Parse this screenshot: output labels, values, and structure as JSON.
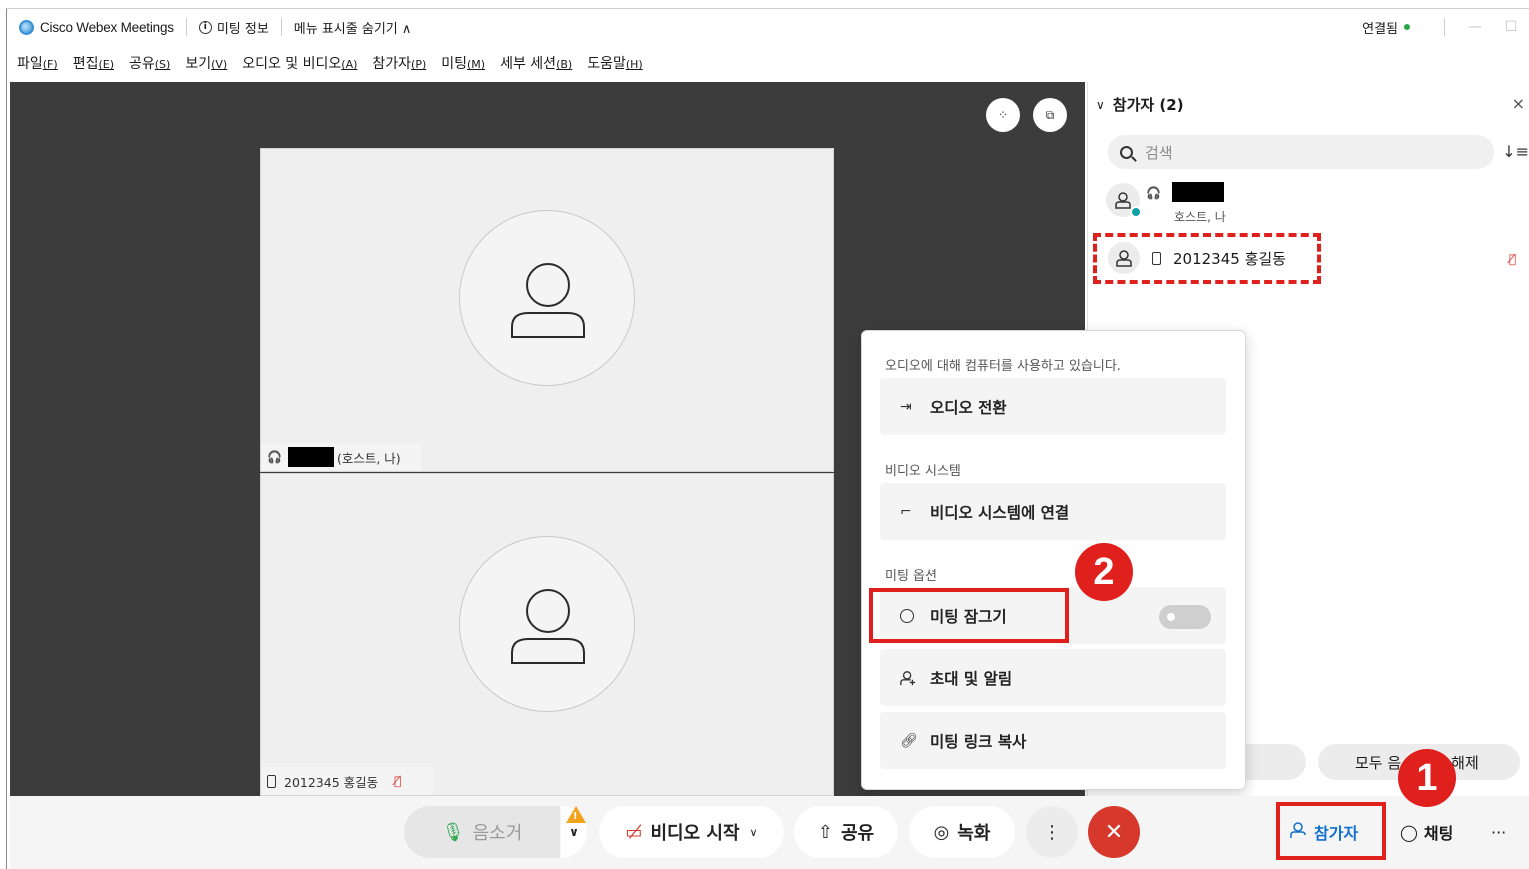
{
  "titlebar": {
    "app_name": "Cisco Webex Meetings",
    "meeting_info": "미팅 정보",
    "hide_menu": "메뉴 표시줄 숨기기 ∧",
    "connection": "연결됨",
    "minimize": "—",
    "maximize": "☐"
  },
  "menu": [
    {
      "label": "파일",
      "key": "(F)"
    },
    {
      "label": "편집",
      "key": "(E)"
    },
    {
      "label": "공유",
      "key": "(S)"
    },
    {
      "label": "보기",
      "key": "(V)"
    },
    {
      "label": "오디오 및 비디오",
      "key": "(A)"
    },
    {
      "label": "참가자",
      "key": "(P)"
    },
    {
      "label": "미팅",
      "key": "(M)"
    },
    {
      "label": "세부 세션",
      "key": "(B)"
    },
    {
      "label": "도움말",
      "key": "(H)"
    }
  ],
  "stage": {
    "tile1_label": "(호스트, 나)",
    "tile2_label": "2012345 홍길동"
  },
  "panel": {
    "title": "참가자 (2)",
    "close": "×",
    "search_placeholder": "검색",
    "host_sub": "호스트, 나",
    "participant_name": "2012345 홍길동",
    "btn_unmute_all_left": "모두 음",
    "btn_unmute_all_right": "해제"
  },
  "popup": {
    "audio_caption": "오디오에 대해 컴퓨터를 사용하고 있습니다.",
    "audio_switch": "오디오 전환",
    "video_system_caption": "비디오 시스템",
    "video_system_connect": "비디오 시스템에 연결",
    "meeting_options_caption": "미팅 옵션",
    "lock_meeting": "미팅 잠그기",
    "lock_meeting_toggle": "off",
    "invite_remind": "초대 및 알림",
    "copy_link": "미팅 링크 복사"
  },
  "badges": {
    "step1": "1",
    "step2": "2"
  },
  "toolbar": {
    "mute": "음소거",
    "start_video": "비디오 시작",
    "share": "공유",
    "record": "녹화",
    "more": "⋮",
    "end": "✕",
    "participants": "참가자",
    "chat": "채팅",
    "overflow": "···"
  },
  "colors": {
    "accent": "#1170cf",
    "highlight": "#e0201c",
    "end_call": "#d6382c",
    "connected": "#28a745"
  }
}
